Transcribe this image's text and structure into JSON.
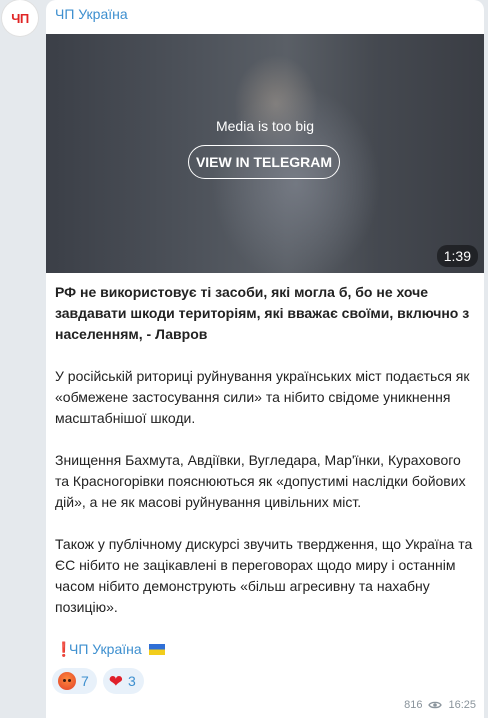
{
  "channel": {
    "name": "ЧП Україна",
    "avatar_text": "ЧП"
  },
  "media": {
    "notice": "Media is too big",
    "button_label": "VIEW IN TELEGRAM",
    "duration": "1:39"
  },
  "post": {
    "headline": "РФ не використовує ті засоби, які могла б, бо не хоче завдавати шкоди територіям, які вважає своїми, включно з населенням, - Лавров",
    "paragraphs": [
      "У російській риториці руйнування українських міст подається як «обмежене застосування сили» та нібито свідоме уникнення масштабнішої шкоди.",
      "Знищення Бахмута, Авдіївки, Вугледара, Мар'їнки, Курахового та Красногорівки пояснюються як «допустимі наслідки бойових дій», а не як масові руйнування цивільних міст.",
      "Також у публічному дискурсі звучить твердження, що Україна та ЄС нібито не зацікавлені в переговорах щодо миру і останнім часом нібито демонструють «більш агресивну та нахабну позицію»."
    ],
    "signature_mark": "❗",
    "signature_link": "ЧП Україна"
  },
  "reactions": [
    {
      "icon": "angry-face-icon",
      "count": "7"
    },
    {
      "icon": "heart-icon",
      "count": "3"
    }
  ],
  "meta": {
    "views": "816",
    "time": "16:25"
  }
}
